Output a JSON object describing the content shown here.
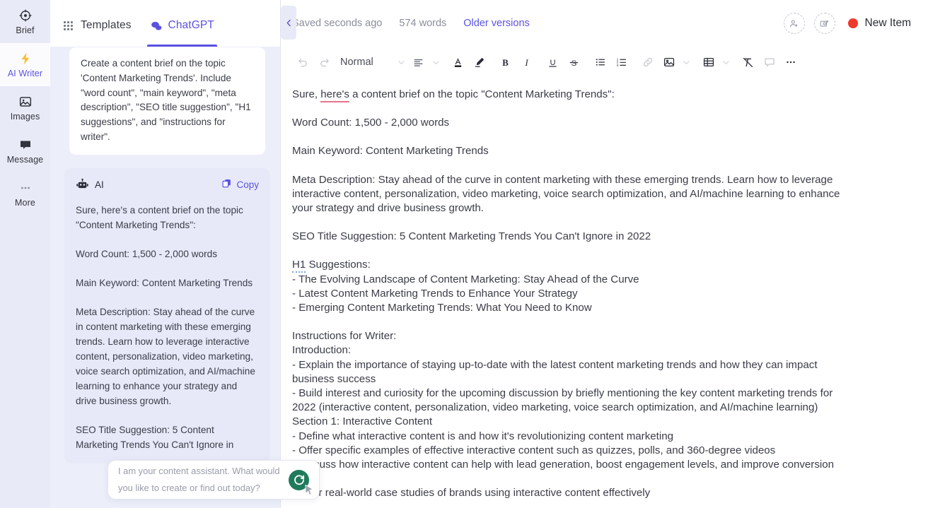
{
  "rail": {
    "items": [
      {
        "label": "Brief",
        "icon": "target-icon",
        "active": false
      },
      {
        "label": "AI Writer",
        "icon": "lightning-icon",
        "active": true
      },
      {
        "label": "Images",
        "icon": "image-icon",
        "active": false
      },
      {
        "label": "Message",
        "icon": "message-icon",
        "active": false
      },
      {
        "label": "More",
        "icon": "ellipsis-icon",
        "active": false
      }
    ]
  },
  "chat": {
    "tabs": [
      {
        "label": "Templates",
        "icon": "grid-icon",
        "active": false
      },
      {
        "label": "ChatGPT",
        "icon": "chat-bubbles-icon",
        "active": true
      }
    ],
    "user_message": "Create a content brief on the topic 'Content Marketing Trends'. Include \"word count\", \"main keyword\", \"meta description\", \"SEO title suggestion\", \"H1 suggestions\", and \"instructions for writer\".",
    "ai_label": "AI",
    "copy_label": "Copy",
    "ai_paragraphs": [
      "Sure, here's a content brief on the topic \"Content Marketing Trends\":",
      "Word Count: 1,500 - 2,000 words",
      "Main Keyword: Content Marketing Trends",
      "Meta Description: Stay ahead of the curve in content marketing with these emerging trends. Learn how to leverage interactive content, personalization, video marketing, voice search optimization, and AI/machine learning to enhance your strategy and drive business growth.",
      "SEO Title Suggestion: 5 Content Marketing Trends You Can't Ignore in"
    ],
    "composer_placeholder": "I am your content assistant. What would you like to create or find out today?",
    "send_icon": "refresh-send-icon",
    "collapse_icon": "chevron-left-icon"
  },
  "editor": {
    "saved_status": "Saved seconds ago",
    "word_count": "574 words",
    "older_versions": "Older versions",
    "share_user_icon": "add-person-icon",
    "share_image_icon": "add-image-icon",
    "new_item_label": "New Item",
    "new_item_color": "#f0392b",
    "toolbar": {
      "style_label": "Normal",
      "items": [
        {
          "name": "undo-icon",
          "dim": true
        },
        {
          "name": "redo-icon",
          "dim": true
        },
        {
          "name": "style-dropdown",
          "dim": false
        },
        {
          "name": "style-chevron-down-icon",
          "dim": true
        },
        {
          "name": "align-icon",
          "dim": false
        },
        {
          "name": "align-chevron-down-icon",
          "dim": true
        },
        {
          "name": "text-color-icon",
          "dim": false
        },
        {
          "name": "highlighter-icon",
          "dim": false
        },
        {
          "name": "bold-icon",
          "dim": false
        },
        {
          "name": "italic-icon",
          "dim": false
        },
        {
          "name": "underline-icon",
          "dim": false
        },
        {
          "name": "strikethrough-icon",
          "dim": false
        },
        {
          "name": "bullet-list-icon",
          "dim": false
        },
        {
          "name": "numbered-list-icon",
          "dim": false
        },
        {
          "name": "link-icon",
          "dim": true
        },
        {
          "name": "insert-image-icon",
          "dim": false
        },
        {
          "name": "image-chevron-down-icon",
          "dim": true
        },
        {
          "name": "insert-table-icon",
          "dim": false
        },
        {
          "name": "table-chevron-down-icon",
          "dim": true
        },
        {
          "name": "clear-formatting-icon",
          "dim": false
        },
        {
          "name": "comment-icon",
          "dim": true
        },
        {
          "name": "more-options-icon",
          "dim": false
        }
      ]
    },
    "document": {
      "intro_pre": "Sure, ",
      "intro_misspelled": "here's",
      "intro_post": " a content brief on the topic \"Content Marketing Trends\":",
      "word_count_line": "Word Count: 1,500 - 2,000 words",
      "main_keyword_line": "Main Keyword: Content Marketing Trends",
      "meta_description_line": "Meta Description: Stay ahead of the curve in content marketing with these emerging trends. Learn how to leverage interactive content, personalization, video marketing, voice search optimization, and AI/machine learning to enhance your strategy and drive business growth.",
      "seo_title_line": "SEO Title Suggestion: 5 Content Marketing Trends You Can't Ignore in 2022",
      "h1_grammar_word": "H1",
      "h1_heading_rest": " Suggestions:",
      "h1_items": [
        "- The Evolving Landscape of Content Marketing: Stay Ahead of the Curve",
        "- Latest Content Marketing Trends to Enhance Your Strategy",
        "- Emerging Content Marketing Trends: What You Need to Know"
      ],
      "instructions_heading": "Instructions for Writer:",
      "introduction_heading": "Introduction:",
      "introduction_items": [
        "- Explain the importance of staying up-to-date with the latest content marketing trends and how they can impact business success",
        "- Build interest and curiosity for the upcoming discussion by briefly mentioning the key content marketing trends for 2022 (interactive content, personalization, video marketing, voice search optimization, and AI/machine learning)"
      ],
      "section1_heading": "Section 1: Interactive Content",
      "section1_items": [
        "- Define what interactive content is and how it's revolutionizing content marketing",
        "- Offer specific examples of effective interactive content such as quizzes, polls, and 360-degree videos",
        "- Discuss how interactive content can help with lead generation, boost engagement levels, and improve conversion rates",
        "- Offer real-world case studies of brands using interactive content effectively"
      ]
    }
  }
}
